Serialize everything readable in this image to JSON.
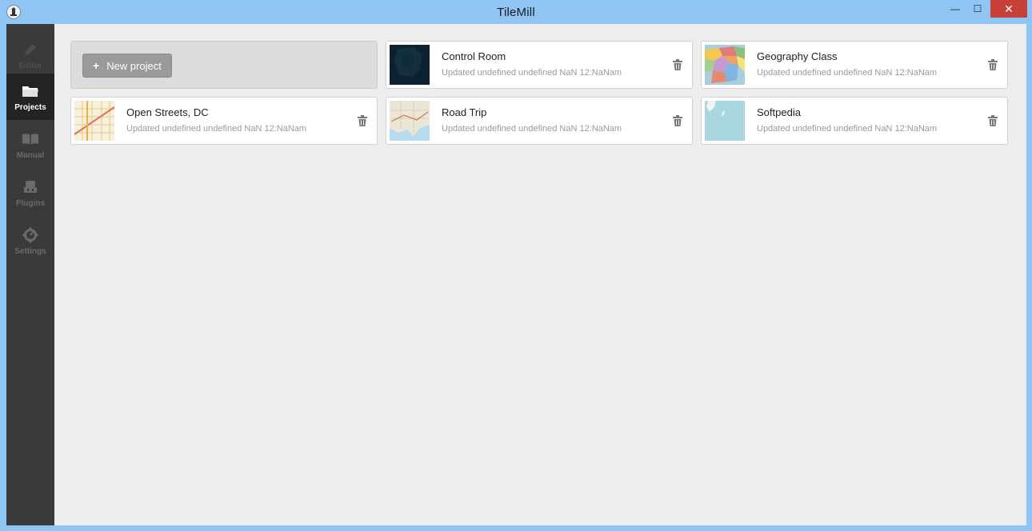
{
  "window": {
    "title": "TileMill",
    "minimize_glyph": "—",
    "maximize_glyph": "☐",
    "close_glyph": "✕"
  },
  "sidebar": {
    "items": [
      {
        "label": "Editor",
        "icon": "pencil-icon",
        "state": "disabled"
      },
      {
        "label": "Projects",
        "icon": "folder-icon",
        "state": "active"
      },
      {
        "label": "Manual",
        "icon": "book-icon",
        "state": "normal"
      },
      {
        "label": "Plugins",
        "icon": "plugin-icon",
        "state": "normal"
      },
      {
        "label": "Settings",
        "icon": "gear-icon",
        "state": "normal"
      }
    ]
  },
  "main": {
    "new_project": {
      "plus": "+",
      "label": "New project"
    },
    "projects": [
      {
        "name": "Control Room",
        "updated": "Updated undefined undefined NaN 12:NaNam",
        "thumb": "dark"
      },
      {
        "name": "Geography Class",
        "updated": "Updated undefined undefined NaN 12:NaNam",
        "thumb": "colorful"
      },
      {
        "name": "Open Streets, DC",
        "updated": "Updated undefined undefined NaN 12:NaNam",
        "thumb": "streets"
      },
      {
        "name": "Road Trip",
        "updated": "Updated undefined undefined NaN 12:NaNam",
        "thumb": "roadtrip"
      },
      {
        "name": "Softpedia",
        "updated": "Updated undefined undefined NaN 12:NaNam",
        "thumb": "ocean"
      }
    ]
  },
  "colors": {
    "titlebar": "#8ec5f5",
    "sidebar": "#3a3a3a",
    "sidebar_active": "#232323",
    "content_bg": "#ededed",
    "close_button": "#c7403a"
  }
}
